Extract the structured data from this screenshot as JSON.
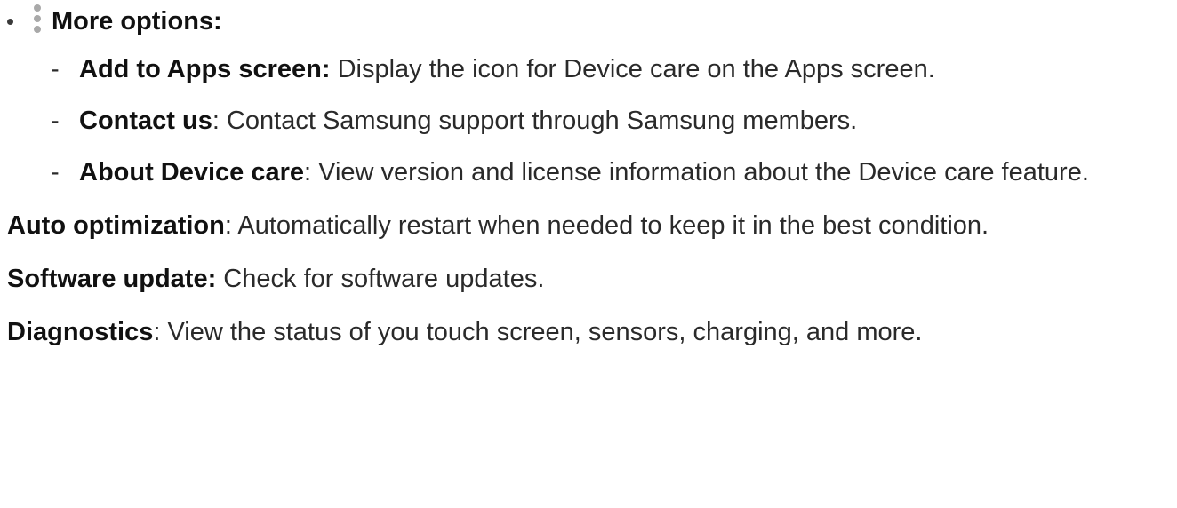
{
  "items": [
    {
      "term": "More options:",
      "desc": "",
      "sub": [
        {
          "term": "Add to Apps screen:",
          "desc": " Display the icon for Device care on the Apps screen."
        },
        {
          "term": "Contact us",
          "desc": ": Contact Samsung support through Samsung members."
        },
        {
          "term": "About Device care",
          "desc": ": View version and license information about the Device care feature."
        }
      ]
    },
    {
      "term": "Auto optimization",
      "desc": ": Automatically restart when needed to keep it in the best condition."
    },
    {
      "term": "Software update:",
      "desc": " Check for software updates."
    },
    {
      "term": "Diagnostics",
      "desc": ": View the status of you touch screen, sensors, charging, and more."
    }
  ],
  "icons": {
    "more_options": "more-options-vertical-dots-icon"
  }
}
